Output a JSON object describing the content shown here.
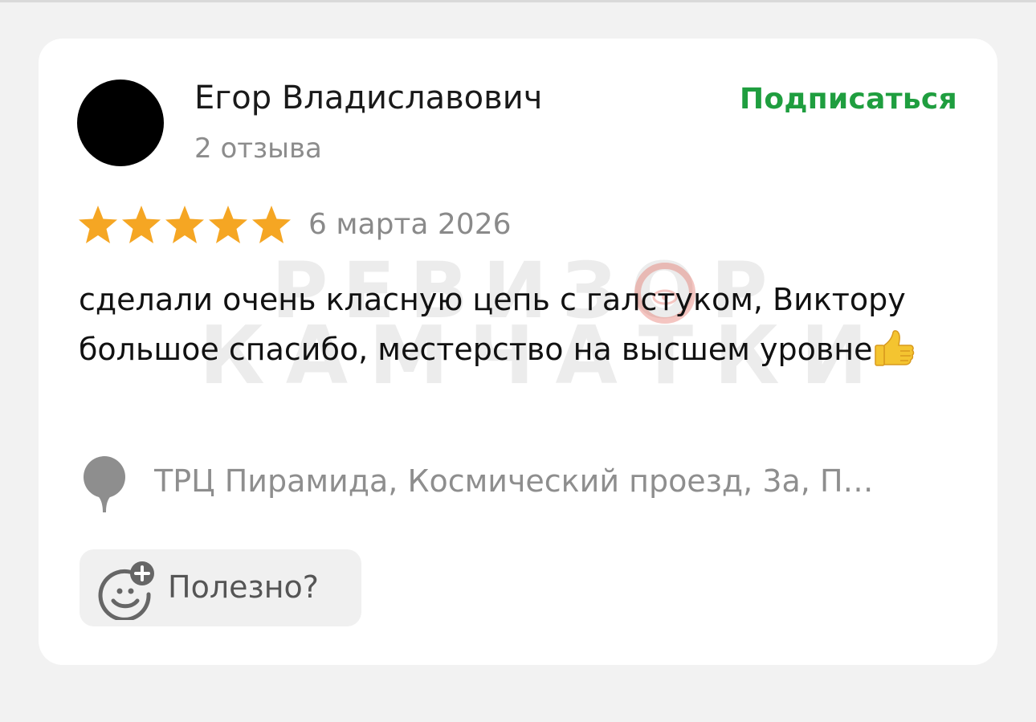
{
  "review": {
    "author": {
      "name": "Егор Владиславович",
      "reviews_count": "2 отзыва"
    },
    "subscribe_label": "Подписаться",
    "rating": 5,
    "rating_max": 5,
    "date": "6 марта 2026",
    "text": "сделали очень класную цепь с галстуком, Виктору большое спасибо, местерство на высшем уровне",
    "location": "ТРЦ Пирамида, Космический проезд, 3а, П…",
    "helpful_label": "Полезно?"
  },
  "watermark": {
    "line1": "РЕВИЗОР",
    "line2": "КАМЧАТКИ"
  },
  "colors": {
    "accent_green": "#1f9e3f",
    "star": "#f5a623",
    "muted_text": "#8c8c8c"
  },
  "icons": {
    "avatar": "avatar",
    "star": "star-icon",
    "thumbs_up": "thumbs-up-emoji",
    "pin": "location-pin-icon",
    "helpful": "smiley-plus-icon"
  }
}
